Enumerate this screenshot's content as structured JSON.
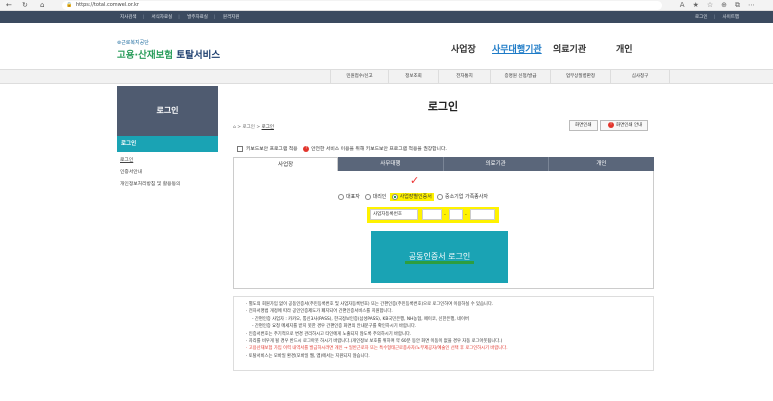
{
  "browser": {
    "url": "https://total.comwel.or.kr"
  },
  "util_bar": {
    "left_items": [
      "지사검색",
      "서식자료실",
      "발주자료실",
      "원격지원"
    ],
    "right_items": [
      "로그인",
      "사이트맵"
    ]
  },
  "brand": {
    "org": "근로복지공단",
    "name_a": "고용·산재보험",
    "name_b": " 토탈서비스"
  },
  "main_nav": [
    {
      "label": "사업장",
      "active": false
    },
    {
      "label": "사무대행기관",
      "active": true
    },
    {
      "label": "의료기관",
      "active": false
    },
    {
      "label": "개인",
      "active": false
    }
  ],
  "sub_menu": [
    "민원접수/신고",
    "정보조회",
    "전자통지",
    "증명원 신청/발급",
    "업무상질병판정",
    "심사청구"
  ],
  "left_panel": {
    "header": "로그인",
    "selected": "로그인",
    "items": [
      "로그인",
      "인증서안내",
      "개인정보처리방침 및 활용동의"
    ]
  },
  "page": {
    "title": "로그인",
    "breadcrumb_home": "⌂",
    "breadcrumb_1": "로그인",
    "breadcrumb_2": "로그인",
    "screen_print": "화면인쇄",
    "screen_guide": "화면인쇄 안내"
  },
  "keyboard_security": {
    "label": "키보드보안 프로그램 적용",
    "warning": "안전한 서비스 이용을 위해 키보드보안 프로그램 적용을 권장합니다."
  },
  "tabs": [
    {
      "label": "사업장",
      "active": true
    },
    {
      "label": "사무대행",
      "active": false
    },
    {
      "label": "의료기관",
      "active": false
    },
    {
      "label": "개인",
      "active": false
    }
  ],
  "radios": [
    {
      "label": "대표자",
      "checked": false
    },
    {
      "label": "대리인",
      "checked": false
    },
    {
      "label": "사업장별인증서",
      "checked": true
    },
    {
      "label": "중소기업 가족종사자",
      "checked": false
    }
  ],
  "biz_number": {
    "label": "사업자등록번호",
    "sep": "-"
  },
  "cert_login_button": "공동인증서 로그인",
  "notes": [
    {
      "text": "· 별도의 회원가입 없이 공동인증서(주민등록번호 및 사업자등록번호) 또는 간편인증(주민등록번호)으로 로그인하여 이용하실 수 있습니다.",
      "style": "normal"
    },
    {
      "text": "· 전자서명법 개정에 따라 공인인증제도가 폐지되어 간편인증서비스를 지원합니다.",
      "style": "normal"
    },
    {
      "text": "- 간편인증 사업자 : 카카오, 통신3사(PASS), 한국정보인증(삼성PASS), KB국민은행, NH농협, 페이코, 신한은행, 네이버",
      "style": "sub"
    },
    {
      "text": "- 간편인증 요청 메세지를 받지 못한 경우 간편인증 화면의 안내문구를 확인하시기 바랍니다.",
      "style": "sub"
    },
    {
      "text": "· 인증서번호는 주기적으로 변경 관리하시고 타인에게 노출되지 않도록 주의하시기 바랍니다.",
      "style": "normal"
    },
    {
      "text": "· 자리를 비우게 될 경우 반드시 로그아웃 하시기 바랍니다.(개인정보 보호를 위하여 약 60분 동안 화면 이동이 없을 경우 자동 로그아웃됩니다.)",
      "style": "normal"
    },
    {
      "text": "· 고용산재보험 가입 이력 내역서를 발급하시려면 개인 → 일반근로자 또는 특수형태근로종사자/노무제공자/예술인 선택 후 로그인하시기 바랍니다.",
      "style": "red"
    },
    {
      "text": "· 토탈서비스는 모바일 환경(모바일 웹, 앱)에서는 지원되지 않습니다.",
      "style": "normal"
    }
  ]
}
